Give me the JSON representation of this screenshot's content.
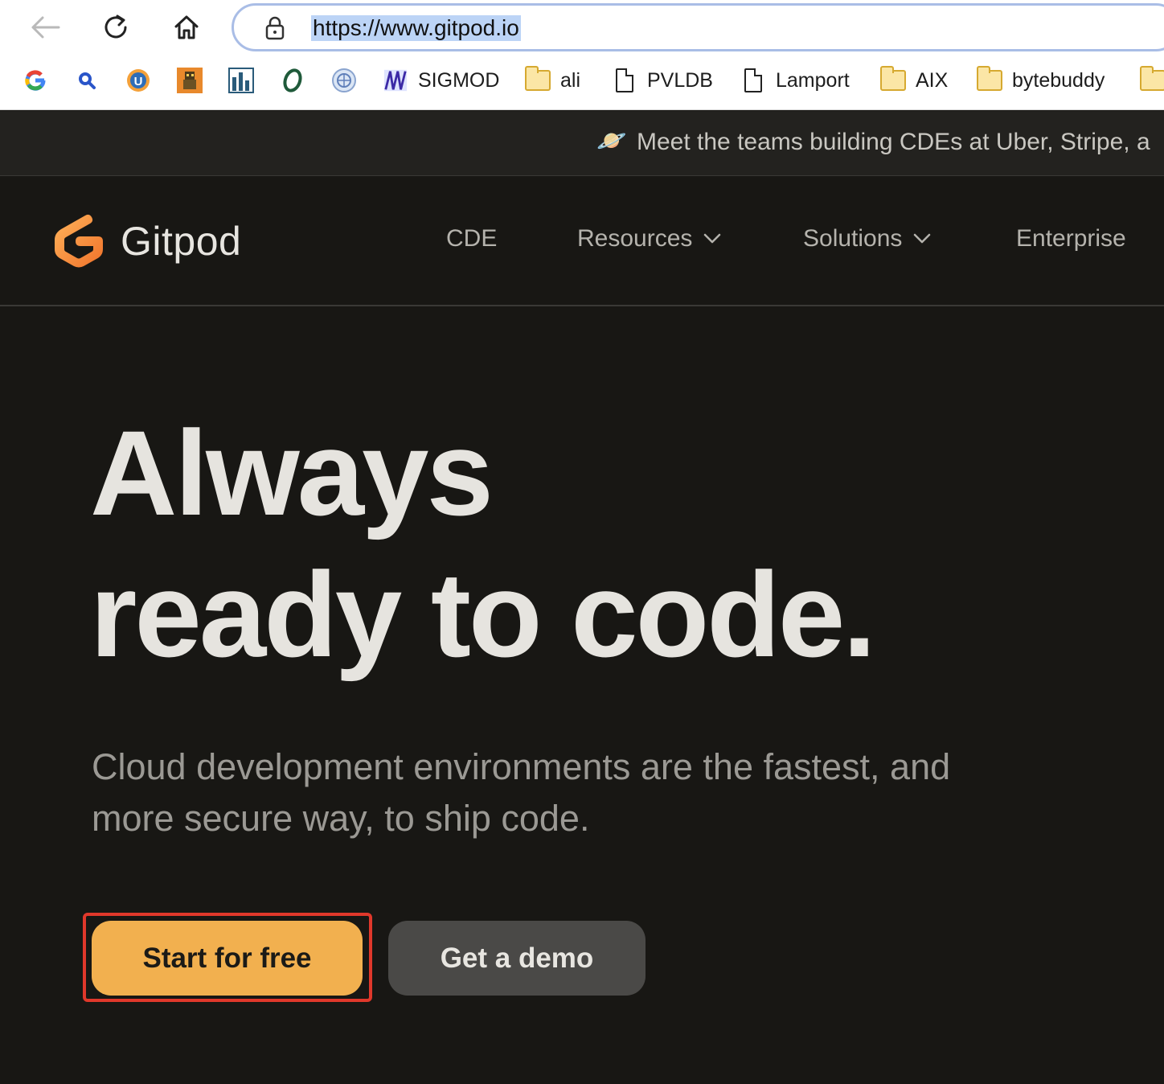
{
  "browser": {
    "url": "https://www.gitpod.io",
    "bookmarks": [
      {
        "label": "",
        "icon": "google-icon"
      },
      {
        "label": "",
        "icon": "search-icon"
      },
      {
        "label": "",
        "icon": "u-badge-icon"
      },
      {
        "label": "",
        "icon": "pixel-avatar-icon"
      },
      {
        "label": "",
        "icon": "bar-chart-icon"
      },
      {
        "label": "",
        "icon": "o-logo-icon"
      },
      {
        "label": "",
        "icon": "globe-seal-icon"
      },
      {
        "label": "SIGMOD",
        "icon": "sigmod-icon"
      },
      {
        "label": "ali",
        "icon": "folder-icon"
      },
      {
        "label": "PVLDB",
        "icon": "document-icon"
      },
      {
        "label": "Lamport",
        "icon": "document-icon"
      },
      {
        "label": "AIX",
        "icon": "folder-icon"
      },
      {
        "label": "bytebuddy",
        "icon": "folder-icon"
      },
      {
        "label": "",
        "icon": "folder-icon"
      }
    ]
  },
  "announcement": {
    "emoji": "🪐",
    "text": "Meet the teams building CDEs at Uber, Stripe, a"
  },
  "nav": {
    "logo_text": "Gitpod",
    "brand_color": "#F2A13B",
    "links": [
      "CDE",
      "Resources",
      "Solutions",
      "Enterprise"
    ]
  },
  "hero": {
    "title_line1": "Always",
    "title_line2": "ready to code.",
    "subtitle": "Cloud development environments are the fastest, and more secure way, to ship code.",
    "primary_cta": "Start for free",
    "secondary_cta": "Get a demo"
  }
}
